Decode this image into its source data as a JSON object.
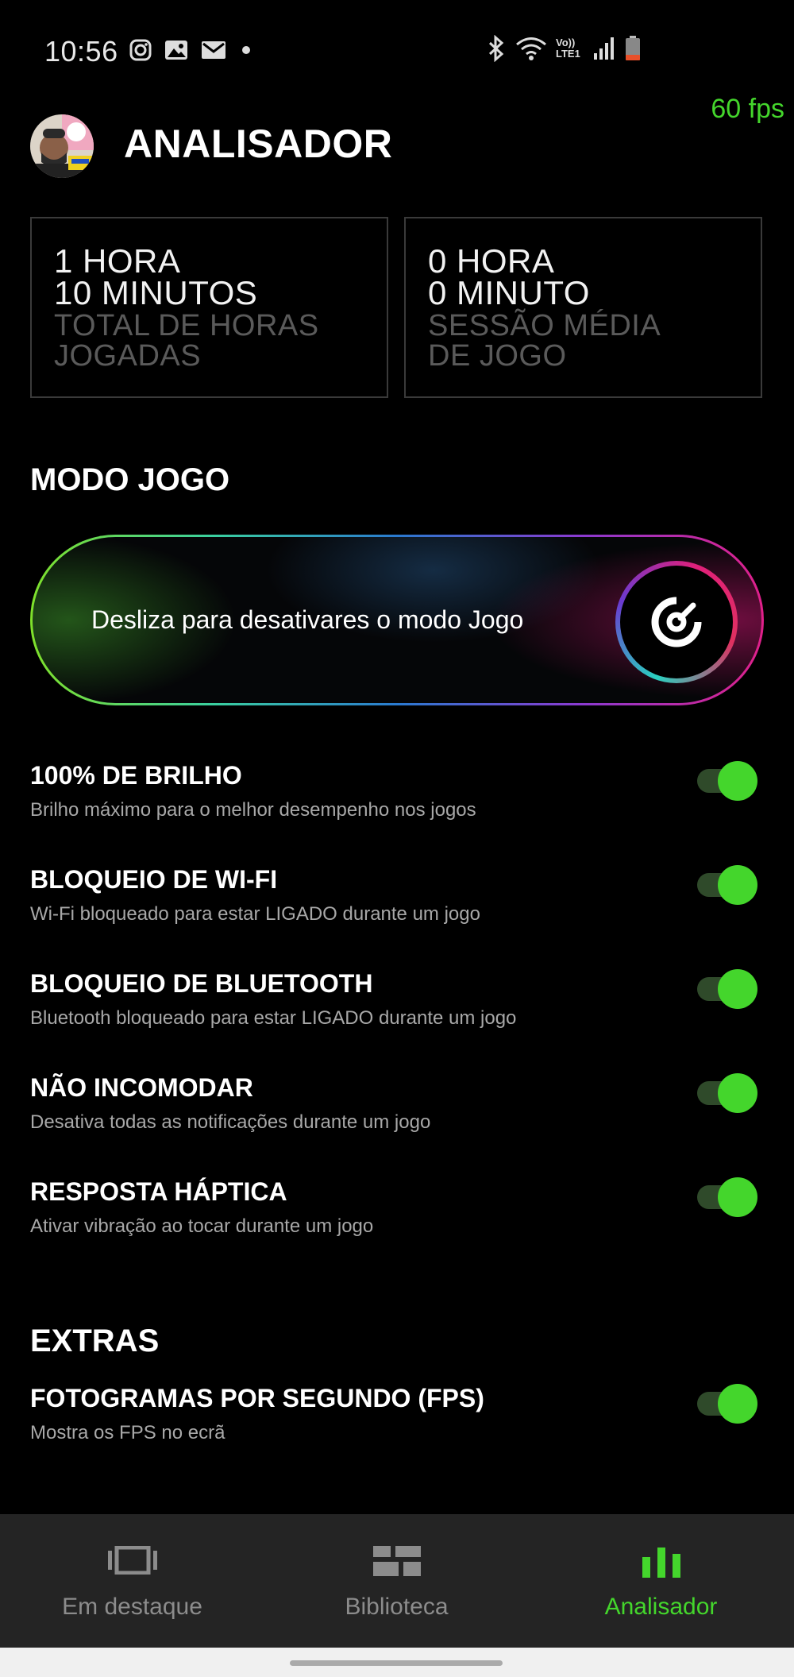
{
  "status_bar": {
    "time": "10:56",
    "left_icons": [
      "instagram-icon",
      "gallery-icon",
      "mail-icon",
      "dot-icon"
    ],
    "right_icons": [
      "bluetooth-icon",
      "wifi-icon",
      "volte-icon",
      "signal-icon",
      "battery-icon"
    ],
    "volte_label": "Vo)) LTE1"
  },
  "fps_overlay": "60 fps",
  "header": {
    "title": "ANALISADOR"
  },
  "stats": [
    {
      "line1": "1 HORA",
      "line2": "10 MINUTOS",
      "label1": "TOTAL DE HORAS",
      "label2": "JOGADAS"
    },
    {
      "line1": "0 HORA",
      "line2": "0 MINUTO",
      "label1": "SESSÃO MÉDIA",
      "label2": "DE JOGO"
    }
  ],
  "game_mode": {
    "heading": "MODO JOGO",
    "slider_label": "Desliza para desativares o modo Jogo",
    "slider_enabled": true
  },
  "settings": [
    {
      "title": "100% DE BRILHO",
      "description": "Brilho máximo para o melhor desempenho nos jogos",
      "enabled": true
    },
    {
      "title": "BLOQUEIO DE WI-FI",
      "description": "Wi-Fi bloqueado para estar LIGADO durante um jogo",
      "enabled": true
    },
    {
      "title": "BLOQUEIO DE BLUETOOTH",
      "description": "Bluetooth bloqueado para estar LIGADO durante um jogo",
      "enabled": true
    },
    {
      "title": "NÃO INCOMODAR",
      "description": "Desativa todas as notificações durante um jogo",
      "enabled": true
    },
    {
      "title": "RESPOSTA HÁPTICA",
      "description": "Ativar vibração ao tocar durante um jogo",
      "enabled": true
    }
  ],
  "extras": {
    "heading": "EXTRAS",
    "items": [
      {
        "title": "FOTOGRAMAS POR SEGUNDO (FPS)",
        "description": "Mostra os FPS no ecrã",
        "enabled": true
      }
    ]
  },
  "bottom_nav": {
    "items": [
      {
        "label": "Em destaque",
        "icon": "carousel-icon",
        "active": false
      },
      {
        "label": "Biblioteca",
        "icon": "library-grid-icon",
        "active": false
      },
      {
        "label": "Analisador",
        "icon": "bar-chart-icon",
        "active": true
      }
    ]
  },
  "colors": {
    "accent": "#44d62c",
    "background": "#000000",
    "nav_background": "#242424"
  }
}
